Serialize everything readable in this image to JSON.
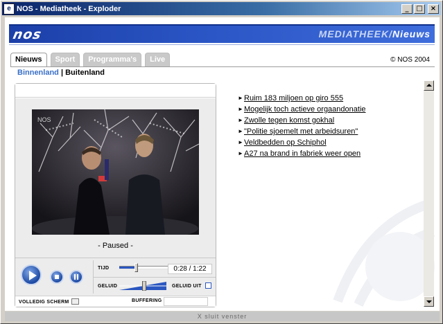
{
  "window": {
    "title": "NOS - Mediatheek - Exploder",
    "min": "_",
    "max": "□",
    "close": "×",
    "icon_glyph": "e"
  },
  "header": {
    "logo": "nos",
    "section_main": "MEDIATHEEK/",
    "section_sub": "Nieuws"
  },
  "tabs": [
    {
      "label": "Nieuws",
      "active": true
    },
    {
      "label": "Sport",
      "active": false
    },
    {
      "label": "Programma's",
      "active": false
    },
    {
      "label": "Live",
      "active": false
    }
  ],
  "copyright": "© NOS 2004",
  "subnav": {
    "active": "Binnenland",
    "separator": " | ",
    "other": "Buitenland"
  },
  "player": {
    "status": "- Paused -",
    "time_label": "TIJD",
    "time_display": "0:28 / 1:22",
    "progress": 0.34,
    "volume_label": "GELUID",
    "volume": 0.53,
    "mute_label": "GELUID UIT",
    "fullscreen_label": "VOLLEDIG SCHERM",
    "buffering_label": "BUFFERING",
    "accent_color": "#2a56c0"
  },
  "news": [
    "Ruim 183 miljoen op giro 555",
    "Mogelijk toch actieve orgaandonatie",
    "Zwolle tegen komst gokhal",
    "\"Politie sjoemelt met arbeidsuren\"",
    "Veldbedden op Schiphol",
    "A27 na brand in fabriek weer open"
  ],
  "news_arrow": "►",
  "footer": "X  sluit venster"
}
